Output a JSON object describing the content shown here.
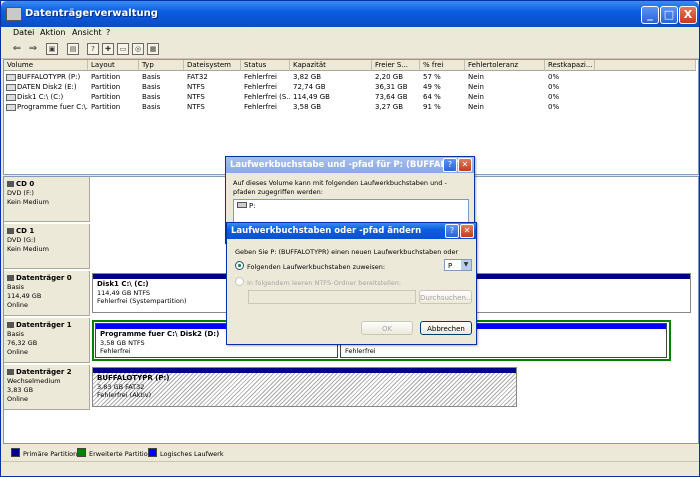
{
  "window": {
    "title": "Datenträgerverwaltung"
  },
  "titlebar_buttons": {
    "minimize": "_",
    "maximize": "□",
    "close": "X"
  },
  "menu": [
    "Datei",
    "Aktion",
    "Ansicht",
    "?"
  ],
  "toolbar": {
    "back": "⇐",
    "forward": "⇒",
    "icons": [
      "up",
      "properties",
      "help",
      "refresh",
      "open",
      "explore",
      "console"
    ]
  },
  "volume_list": {
    "columns": [
      "Volume",
      "Layout",
      "Typ",
      "Dateisystem",
      "Status",
      "Kapazität",
      "Freier S...",
      "% frei",
      "Fehlertoleranz",
      "Restkapazi..."
    ],
    "rows": [
      [
        "BUFFALOTYPR (P:)",
        "Partition",
        "Basis",
        "FAT32",
        "Fehlerfrei",
        "3,82 GB",
        "2,20 GB",
        "57 %",
        "Nein",
        "0%"
      ],
      [
        "DATEN Disk2 (E:)",
        "Partition",
        "Basis",
        "NTFS",
        "Fehlerfrei",
        "72,74 GB",
        "36,31 GB",
        "49 %",
        "Nein",
        "0%"
      ],
      [
        "Disk1 C:\\ (C:)",
        "Partition",
        "Basis",
        "NTFS",
        "Fehlerfrei (S...",
        "114,49 GB",
        "73,64 GB",
        "64 %",
        "Nein",
        "0%"
      ],
      [
        "Programme fuer C:\\...",
        "Partition",
        "Basis",
        "NTFS",
        "Fehlerfrei",
        "3,58 GB",
        "3,27 GB",
        "91 %",
        "Nein",
        "0%"
      ]
    ]
  },
  "disks": [
    {
      "name": "CD 0",
      "lines": [
        "DVD (F:)",
        "",
        "Kein Medium"
      ]
    },
    {
      "name": "CD 1",
      "lines": [
        "DVD (G:)",
        "",
        "Kein Medium"
      ]
    },
    {
      "name": "Datenträger 0",
      "lines": [
        "Basis",
        "114,49 GB",
        "Online"
      ]
    },
    {
      "name": "Datenträger 1",
      "lines": [
        "Basis",
        "76,32 GB",
        "Online"
      ]
    },
    {
      "name": "Datenträger 2",
      "lines": [
        "Wechselmedium",
        "3,83 GB",
        "Online"
      ]
    }
  ],
  "volumes": {
    "disk0": {
      "name": "Disk1 C:\\  (C:)",
      "size": "114,49 GB NTFS",
      "status": "Fehlerfrei (Systempartition)"
    },
    "disk1a": {
      "name": "Programme fuer C:\\ Disk2  (D:)",
      "size": "3,58 GB NTFS",
      "status": "Fehlerfrei"
    },
    "disk1b": {
      "name": "",
      "size": "",
      "status": "Fehlerfrei"
    },
    "disk2": {
      "name": "BUFFALOTYPR  (P:)",
      "size": "3,83 GB FAT32",
      "status": "Fehlerfrei (Aktiv)"
    }
  },
  "legend": [
    {
      "label": "Primäre Partition",
      "color": "#00008b"
    },
    {
      "label": "Erweiterte Partition",
      "color": "#008000"
    },
    {
      "label": "Logisches Laufwerk",
      "color": "#0000ff"
    }
  ],
  "dialog_back": {
    "title": "Laufwerkbuchstabe und -pfad für P: (BUFFALOTY...",
    "text": "Auf dieses Volume kann mit folgenden Laufwerkbuchstaben und -pfaden zugegriffen werden:",
    "entry": "P:"
  },
  "dialog_front": {
    "title": "Laufwerkbuchstaben oder -pfad ändern",
    "prompt": "Geben Sie P: (BUFFALOTYPR) einen neuen Laufwerkbuchstaben oder",
    "option1": "Folgenden Laufwerkbuchstaben zuweisen:",
    "drive_letter": "P",
    "option2": "In folgendem leeren NTFS-Ordner bereitstellen:",
    "browse": "Durchsuchen...",
    "ok": "OK",
    "cancel": "Abbrechen"
  }
}
